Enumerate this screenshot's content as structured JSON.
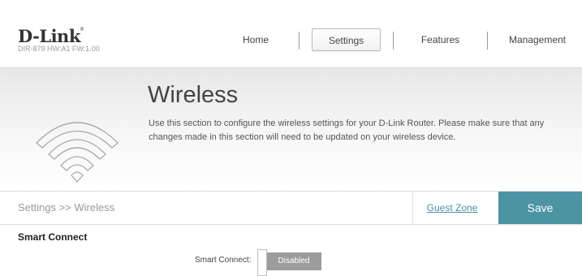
{
  "brand": {
    "logo": "D-Link",
    "trademark": "®",
    "model": "DIR-879 HW:A1 FW:1.00"
  },
  "nav": {
    "items": [
      {
        "label": "Home",
        "active": false
      },
      {
        "label": "Settings",
        "active": true
      },
      {
        "label": "Features",
        "active": false
      },
      {
        "label": "Management",
        "active": false
      }
    ]
  },
  "banner": {
    "title": "Wireless",
    "description": "Use this section to configure the wireless settings for your D-Link Router. Please make sure that any changes made in this section will need to be updated on your wireless device.",
    "icon": "wifi-icon"
  },
  "breadcrumb": {
    "text": "Settings >> Wireless"
  },
  "actions": {
    "guest_zone": "Guest Zone",
    "save": "Save"
  },
  "section": {
    "title": "Smart Connect",
    "smart_connect": {
      "label": "Smart Connect:",
      "value": "Disabled",
      "enabled": false
    }
  },
  "colors": {
    "accent": "#4c93a3",
    "toggle_off": "#9c9c9c",
    "link": "#4a90a4"
  }
}
